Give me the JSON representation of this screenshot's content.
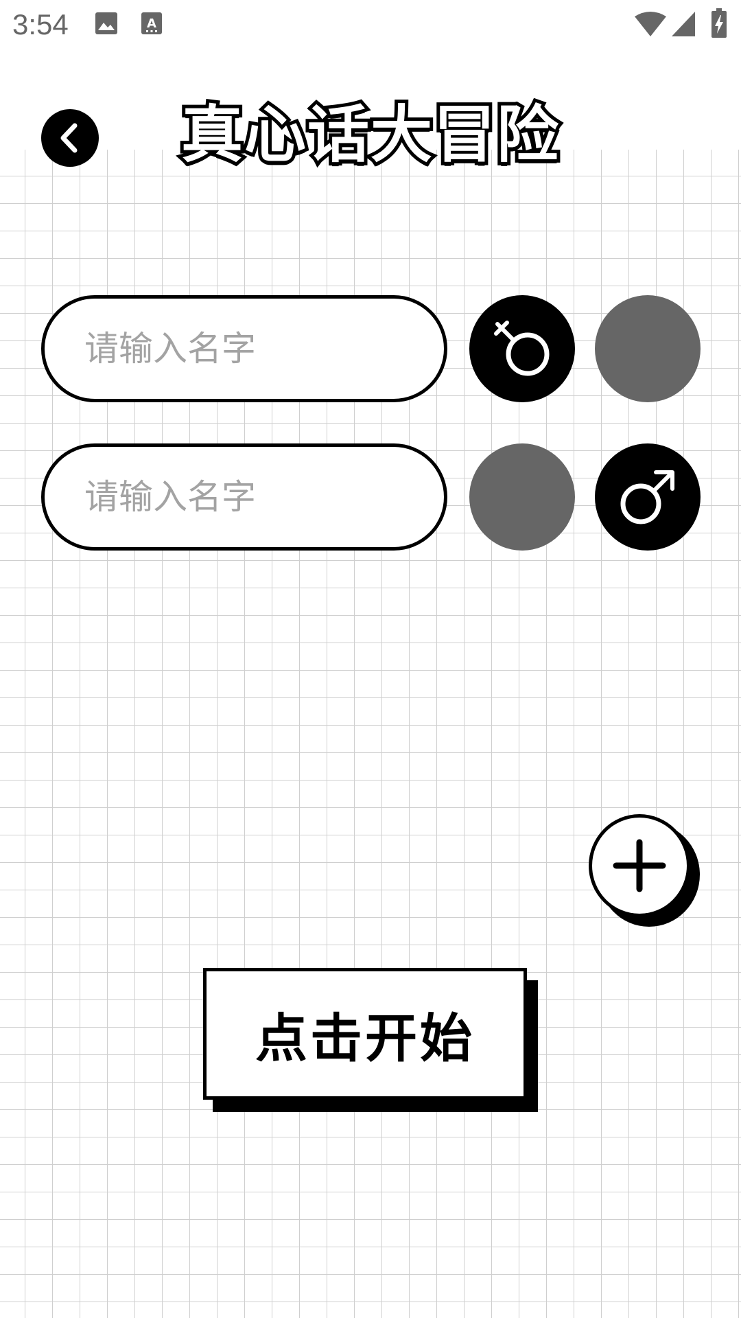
{
  "status_bar": {
    "time": "3:54",
    "icons": [
      "image-icon",
      "text-a-icon",
      "wifi-icon",
      "cell-signal-icon",
      "battery-charging-icon"
    ]
  },
  "header": {
    "title": "真心话大冒险",
    "back_icon": "chevron-left-icon"
  },
  "players": [
    {
      "name_value": "",
      "placeholder": "请输入名字",
      "selected_gender": "female"
    },
    {
      "name_value": "",
      "placeholder": "请输入名字",
      "selected_gender": "male"
    }
  ],
  "gender_icons": {
    "female": "female-symbol-icon",
    "male": "male-symbol-icon"
  },
  "add_button": {
    "icon": "plus-icon"
  },
  "start_button": {
    "label": "点击开始"
  },
  "colors": {
    "primary": "#000000",
    "inactive": "#666666",
    "grid_line": "#cfcfcf",
    "placeholder": "#a3a3a3",
    "background": "#ffffff"
  }
}
